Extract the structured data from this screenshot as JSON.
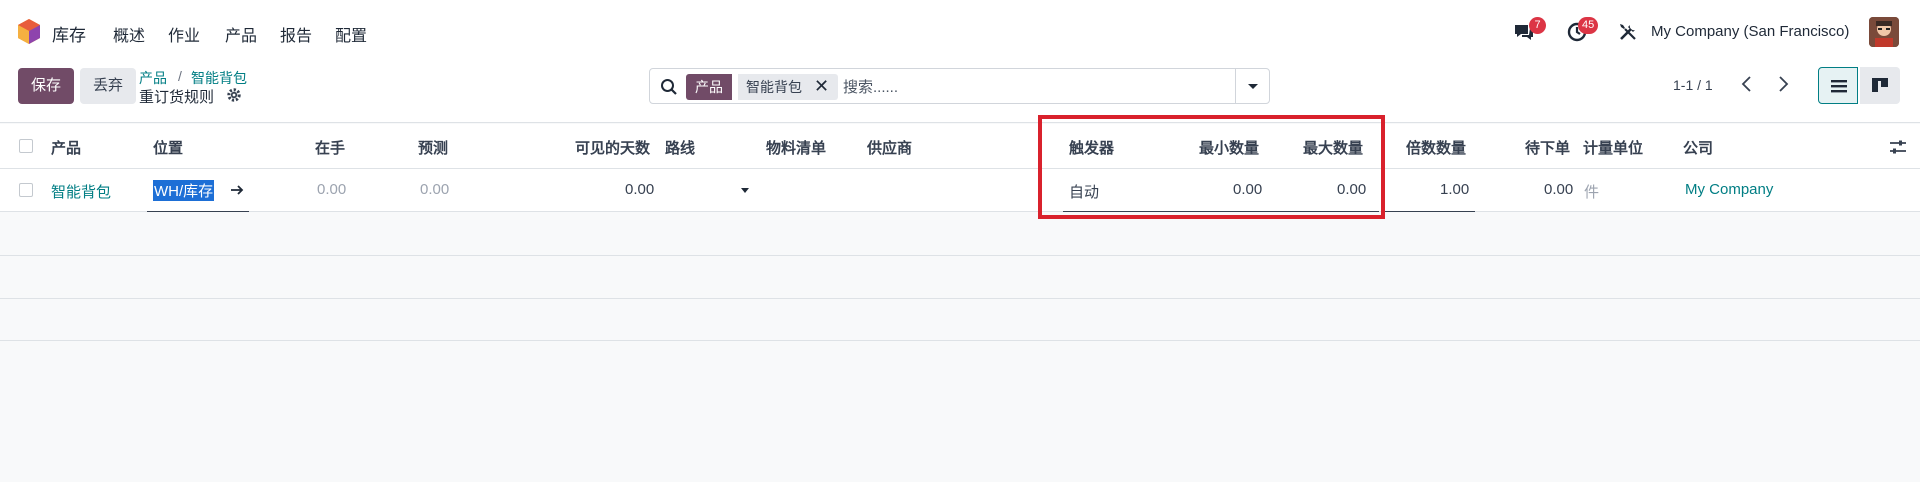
{
  "app": {
    "name": "库存",
    "brand_color": "#714b67",
    "accent": "#017e84"
  },
  "nav": {
    "menu": [
      "概述",
      "作业",
      "产品",
      "报告",
      "配置"
    ]
  },
  "systray": {
    "messages_count": "7",
    "activity_count": "45",
    "company": "My Company (San Francisco)"
  },
  "control": {
    "save_label": "保存",
    "discard_label": "丢弃",
    "breadcrumb": [
      "产品",
      "智能背包"
    ],
    "title": "重订货规则"
  },
  "search": {
    "facet_label": "产品",
    "facet_value": "智能背包",
    "placeholder": "搜索......"
  },
  "pager": {
    "text": "1-1 / 1"
  },
  "table": {
    "headers": {
      "product": "产品",
      "location": "位置",
      "on_hand": "在手",
      "forecast": "预测",
      "visible_days": "可见的天数",
      "route": "路线",
      "bom": "物料清单",
      "vendor": "供应商",
      "trigger": "触发器",
      "min_qty": "最小数量",
      "max_qty": "最大数量",
      "multiple_qty": "倍数数量",
      "to_order": "待下单",
      "uom": "计量单位",
      "company": "公司"
    },
    "rows": [
      {
        "product": "智能背包",
        "location": "WH/库存",
        "on_hand": "0.00",
        "forecast": "0.00",
        "visible_days": "0.00",
        "route": "",
        "bom": "",
        "vendor": "",
        "trigger": "自动",
        "min_qty": "0.00",
        "max_qty": "0.00",
        "multiple_qty": "1.00",
        "to_order": "0.00",
        "uom": "件",
        "company": "My Company"
      }
    ]
  },
  "highlight_color": "#d9212c"
}
